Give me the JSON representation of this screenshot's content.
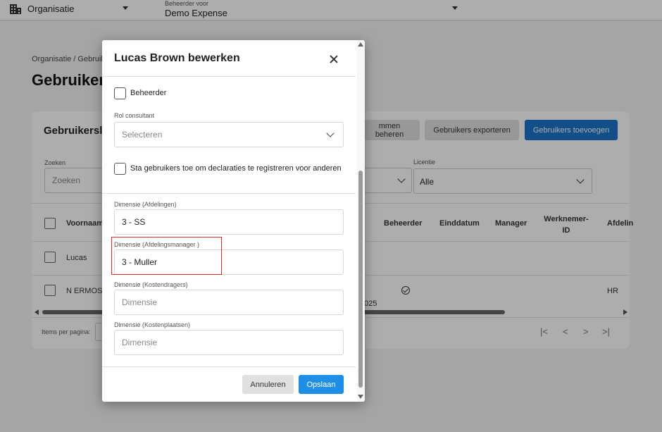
{
  "topbar": {
    "org_label": "Organisatie",
    "admin_small": "Beheerder voor",
    "admin_value": "Demo Expense"
  },
  "page": {
    "breadcrumb": "Organisatie / Gebruik",
    "title": "Gebruikers"
  },
  "card": {
    "title": "Gebruikersl",
    "buttons": {
      "manage": "mmen beheren",
      "export": "Gebruikers exporteren",
      "add": "Gebruikers toevoegen"
    },
    "search": {
      "label": "Zoeken",
      "placeholder": "Zoeken"
    },
    "license": {
      "label": "Licentie",
      "value": "Alle"
    },
    "columns": {
      "first_name": "Voornaam",
      "admin": "Beheerder",
      "end_date": "Einddatum",
      "manager": "Manager",
      "employee_id": "Werknemer-ID",
      "department": "Afdelin"
    },
    "rows": [
      {
        "first_name": "Lucas"
      },
      {
        "first_name": "N ERMOSO",
        "date_fragment": "025",
        "department": "HR"
      }
    ],
    "items_per_page": "Items per pagina:",
    "pager": {
      "first": "|<",
      "prev": "<",
      "next": ">",
      "last": ">|"
    }
  },
  "modal": {
    "title": "Lucas Brown bewerken",
    "admin_checkbox": "Beheerder",
    "role_label": "Rol consultant",
    "role_placeholder": "Selecteren",
    "allow_checkbox": "Sta gebruikers toe om declaraties te registreren voor anderen",
    "dim_departments_label": "Dimensie (Afdelingen)",
    "dim_departments_value": "3 - SS",
    "dim_manager_label": "Dimensie (Afdelingsmanager )",
    "dim_manager_value": "3 - Muller",
    "dim_costcarriers_label": "Dimensie (Kostendragers)",
    "dim_costcarriers_placeholder": "Dimensie",
    "dim_costcenters_label": "Dimensie (Kostenplaatsen)",
    "dim_costcenters_placeholder": "Dimensie",
    "cancel": "Annuleren",
    "save": "Opslaan"
  },
  "colors": {
    "primary": "#1e8fe4",
    "primary_dark": "#1b73c9",
    "highlight": "#d9302b"
  }
}
